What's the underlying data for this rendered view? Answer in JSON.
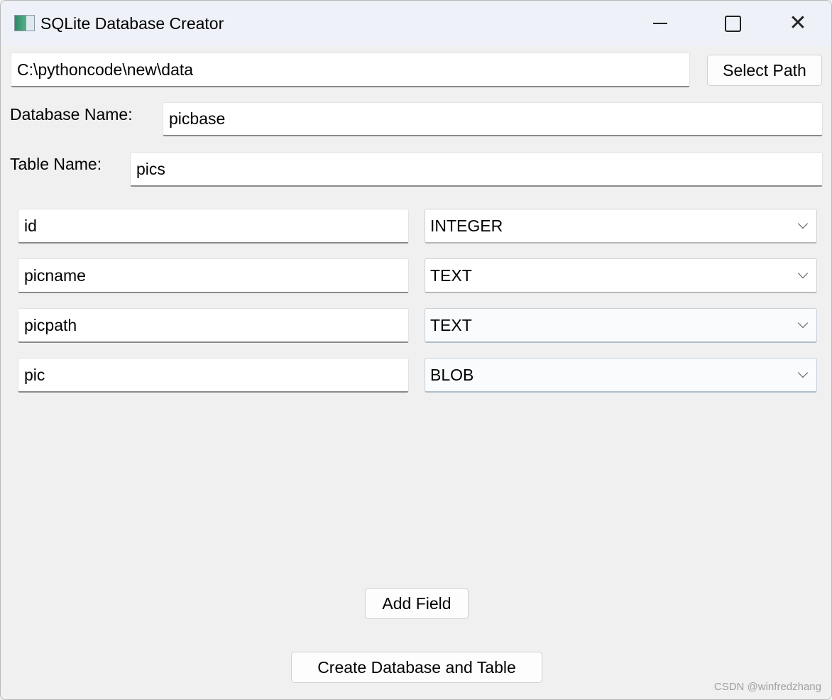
{
  "window": {
    "title": "SQLite Database Creator",
    "close_glyph": "✕"
  },
  "path": {
    "value": "C:\\pythoncode\\new\\data",
    "button": "Select Path"
  },
  "database": {
    "label": "Database Name:",
    "value": "picbase"
  },
  "table": {
    "label": "Table Name:",
    "value": "pics"
  },
  "fields": [
    {
      "name": "id",
      "type": "INTEGER"
    },
    {
      "name": "picname",
      "type": "TEXT"
    },
    {
      "name": "picpath",
      "type": "TEXT"
    },
    {
      "name": "pic",
      "type": "BLOB"
    }
  ],
  "buttons": {
    "add_field": "Add Field",
    "create": "Create Database and Table"
  },
  "watermark": "CSDN @winfredzhang"
}
